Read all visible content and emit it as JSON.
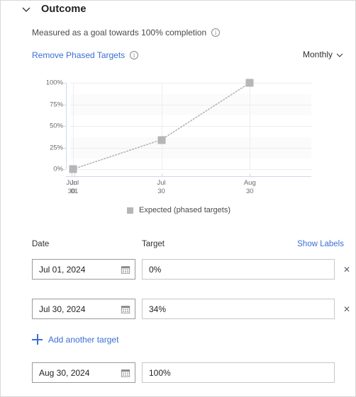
{
  "section": {
    "title": "Outcome",
    "collapse_icon": "chevron-down-icon",
    "subtitle": "Measured as a goal towards 100% completion",
    "subtitle_info_icon": "info-icon",
    "remove_link": "Remove Phased Targets",
    "remove_link_info_icon": "info-icon",
    "cadence_value": "Monthly",
    "cadence_icon": "chevron-down-icon"
  },
  "chart_data": {
    "type": "line",
    "title": "",
    "xlabel": "",
    "ylabel": "",
    "ylim": [
      0,
      100
    ],
    "ytick_labels": [
      "100%",
      "75%",
      "50%",
      "25%",
      "0%"
    ],
    "ytick_values": [
      100,
      75,
      50,
      25,
      0
    ],
    "grid": true,
    "legend_position": "bottom",
    "x_tick_labels": [
      {
        "line1": "Jun",
        "line2": "30"
      },
      {
        "line1": "Jul",
        "line2": "01"
      },
      {
        "line1": "Jul",
        "line2": "30"
      },
      {
        "line1": "Aug",
        "line2": "30"
      }
    ],
    "categories": [
      "Jul 01",
      "Jul 30",
      "Aug 30"
    ],
    "series": [
      {
        "name": "Expected (phased targets)",
        "color": "#b6b6b6",
        "style": "dotted",
        "marker": "square",
        "values": [
          0,
          34,
          100
        ]
      }
    ]
  },
  "table": {
    "headers": {
      "date": "Date",
      "target": "Target"
    },
    "show_labels_link": "Show Labels",
    "rows": [
      {
        "date": "Jul 01, 2024",
        "target": "0%",
        "deletable": true,
        "delete_icon": "close-icon",
        "calendar_icon": "calendar-icon"
      },
      {
        "date": "Jul 30, 2024",
        "target": "34%",
        "deletable": true,
        "delete_icon": "close-icon",
        "calendar_icon": "calendar-icon"
      },
      {
        "date": "Aug 30, 2024",
        "target": "100%",
        "deletable": false,
        "delete_icon": "",
        "calendar_icon": "calendar-icon"
      }
    ],
    "add_button_label": "Add another target",
    "add_button_icon": "plus-icon"
  },
  "colors": {
    "link": "#3b6fd4",
    "series": "#b6b6b6",
    "axis": "#cfd8e8",
    "text": "#201f1e"
  }
}
